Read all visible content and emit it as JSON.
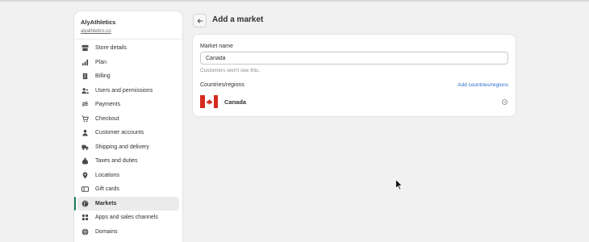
{
  "store": {
    "name": "AlyAthletics",
    "url": "alyathletics.co"
  },
  "sidebar": {
    "items": [
      {
        "label": "Store details",
        "icon": "store-icon"
      },
      {
        "label": "Plan",
        "icon": "plan-icon"
      },
      {
        "label": "Billing",
        "icon": "billing-icon"
      },
      {
        "label": "Users and permissions",
        "icon": "users-icon"
      },
      {
        "label": "Payments",
        "icon": "payments-icon"
      },
      {
        "label": "Checkout",
        "icon": "cart-icon"
      },
      {
        "label": "Customer accounts",
        "icon": "person-icon"
      },
      {
        "label": "Shipping and delivery",
        "icon": "truck-icon"
      },
      {
        "label": "Taxes and duties",
        "icon": "tax-icon"
      },
      {
        "label": "Locations",
        "icon": "location-icon"
      },
      {
        "label": "Gift cards",
        "icon": "gift-card-icon"
      },
      {
        "label": "Markets",
        "icon": "globe-icon",
        "active": true
      },
      {
        "label": "Apps and sales channels",
        "icon": "apps-icon"
      },
      {
        "label": "Domains",
        "icon": "domains-icon"
      }
    ]
  },
  "header": {
    "title": "Add a market",
    "back_icon": "arrow-left-icon"
  },
  "form": {
    "market_name_label": "Market name",
    "market_name_value": "Canada",
    "market_name_help": "Customers won't see this.",
    "countries_label": "Countries/regions",
    "add_countries_link": "Add countries/regions",
    "countries": [
      {
        "name": "Canada",
        "flag": "canada-flag-icon"
      }
    ]
  },
  "colors": {
    "accent": "#1a7f5a",
    "link": "#2c6ecb",
    "flag_red": "#d52b1e"
  }
}
